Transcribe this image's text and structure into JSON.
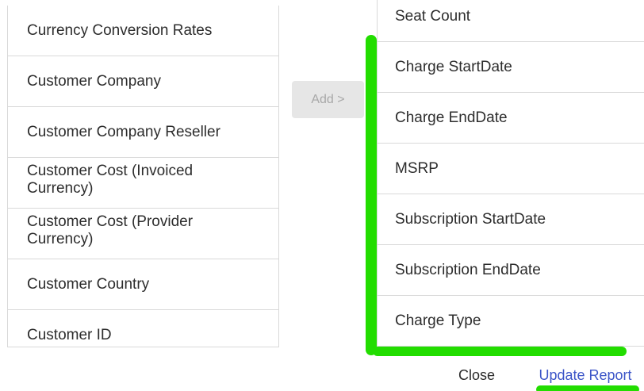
{
  "available_fields": {
    "items": [
      "Currency Conversion Rates",
      "Customer Company",
      "Customer Company Reseller",
      "Customer Cost (Invoiced Currency)",
      "Customer Cost (Provider Currency)",
      "Customer Country",
      "Customer ID"
    ]
  },
  "add_button": {
    "label": "Add >"
  },
  "selected_fields": {
    "items": [
      "Seat Count",
      "Charge StartDate",
      "Charge EndDate",
      "MSRP",
      "Subscription StartDate",
      "Subscription EndDate",
      "Charge Type"
    ]
  },
  "footer": {
    "close_label": "Close",
    "update_label": "Update Report"
  },
  "colors": {
    "highlight": "#22dd00",
    "primary_link": "#3c55c8",
    "disabled_bg": "#e6e6e6"
  }
}
